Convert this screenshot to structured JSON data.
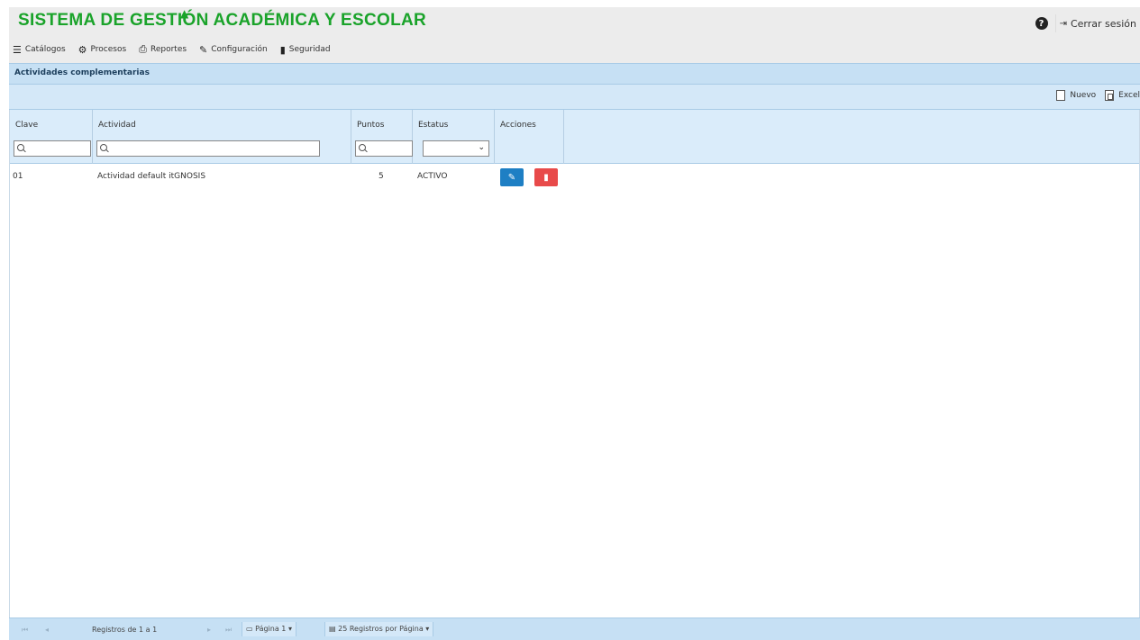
{
  "header": {
    "title": "SISTEMA DE GESTIÓN ACADÉMICA Y ESCOLAR",
    "logout_label": "Cerrar sesión"
  },
  "menu": [
    {
      "label": "Catálogos",
      "icon": "list-icon"
    },
    {
      "label": "Procesos",
      "icon": "gear-icon"
    },
    {
      "label": "Reportes",
      "icon": "printer-icon"
    },
    {
      "label": "Configuración",
      "icon": "wrench-icon"
    },
    {
      "label": "Seguridad",
      "icon": "lock-icon"
    }
  ],
  "panel": {
    "title": "Actividades complementarias"
  },
  "toolbar": {
    "new_label": "Nuevo",
    "excel_label": "Excel"
  },
  "grid": {
    "columns": [
      {
        "key": "clave",
        "label": "Clave"
      },
      {
        "key": "actividad",
        "label": "Actividad"
      },
      {
        "key": "puntos",
        "label": "Puntos"
      },
      {
        "key": "estatus",
        "label": "Estatus"
      },
      {
        "key": "acciones",
        "label": "Acciones"
      }
    ],
    "rows": [
      {
        "clave": "01",
        "actividad": "Actividad default itGNOSIS",
        "puntos": "5",
        "estatus": "ACTIVO"
      }
    ]
  },
  "pager": {
    "records_text": "Registros de 1 a 1",
    "page_text": "Página 1",
    "per_page_text": "25 Registros por Página"
  },
  "colors": {
    "brand": "#1aa32a",
    "header_bg": "#ececec",
    "panel_bg": "#c6e0f4",
    "edit_button": "#1e7fc4",
    "delete_button": "#e84a4a"
  }
}
